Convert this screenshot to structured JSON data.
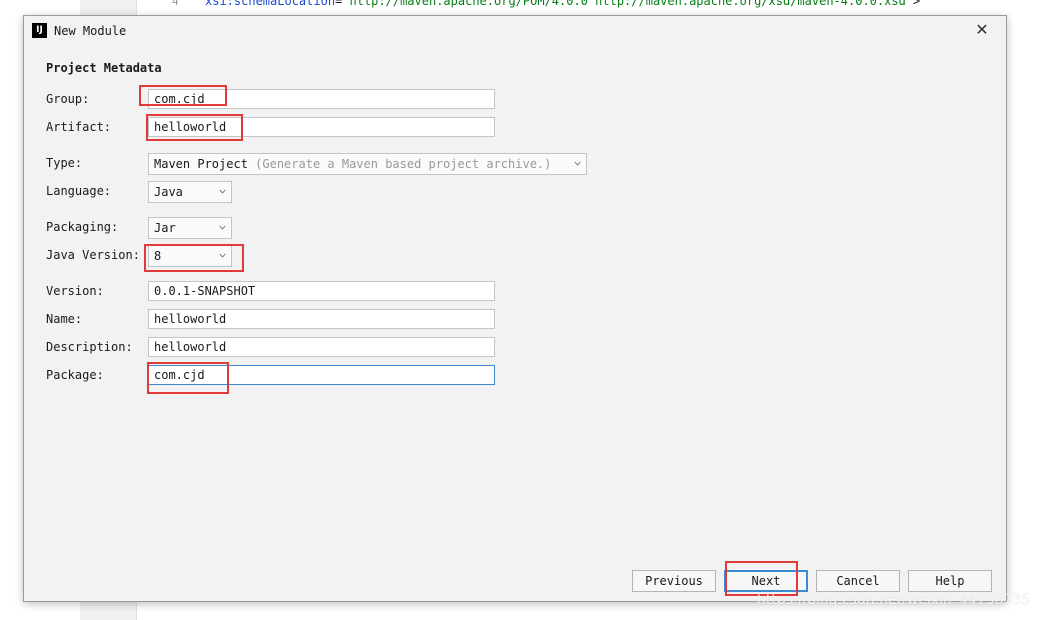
{
  "editor": {
    "line_number": "4",
    "code_attr": "xsi:schemaLocation",
    "code_eq": "=",
    "code_value": "\"http://maven.apache.org/POM/4.0.0 http://maven.apache.org/xsd/maven-4.0.0.xsd\"",
    "code_end": ">"
  },
  "dialog": {
    "icon": "intellij-icon",
    "title": "New Module",
    "close_symbol": "✕"
  },
  "section": {
    "title": "Project Metadata"
  },
  "form": {
    "group": {
      "label": "Group:",
      "value": "com.cjd"
    },
    "artifact": {
      "label": "Artifact:",
      "value": "helloworld"
    },
    "type": {
      "label": "Type:",
      "value": "Maven Project",
      "hint": "(Generate a Maven based project archive.)"
    },
    "language": {
      "label": "Language:",
      "value": "Java"
    },
    "packaging": {
      "label": "Packaging:",
      "value": "Jar"
    },
    "java_version": {
      "label": "Java Version:",
      "value": "8"
    },
    "version": {
      "label": "Version:",
      "value": "0.0.1-SNAPSHOT"
    },
    "name": {
      "label": "Name:",
      "value": "helloworld"
    },
    "description": {
      "label": "Description:",
      "value": "helloworld"
    },
    "package": {
      "label": "Package:",
      "value": "com.cjd"
    }
  },
  "buttons": {
    "previous": "Previous",
    "next": "Next",
    "cancel": "Cancel",
    "help": "Help"
  },
  "watermark": "https://blog.csdn.net/weixin_44736735",
  "colors": {
    "highlight": "#e03a3a",
    "focus": "#3c8ad3",
    "dialog_bg": "#f2f2f2"
  }
}
